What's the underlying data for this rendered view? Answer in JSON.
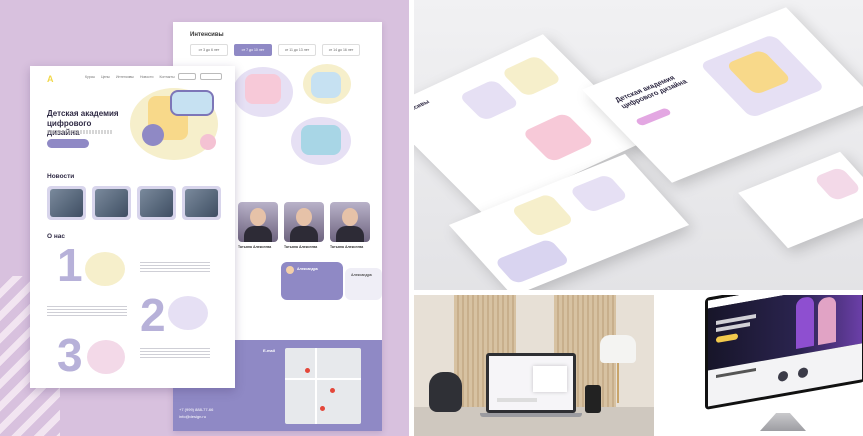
{
  "left_mockup": {
    "back_page": {
      "section_title": "Интенсивы",
      "tabs": [
        {
          "label": "от 3 до 6 лет",
          "active": false
        },
        {
          "label": "от 7 до 10 лет",
          "active": true
        },
        {
          "label": "от 11 до 13 лет",
          "active": false
        },
        {
          "label": "от 14 до 16 лет",
          "active": false
        }
      ],
      "people": [
        "Татьяна Алексеева",
        "Татьяна Алексеева",
        "Татьяна Алексеева"
      ],
      "chat_name": "Александра",
      "chat_name_2": "Александра",
      "footer_label": "E-mail",
      "footer_contacts": [
        "+7 (999) 888-77-66",
        "info@design.ru"
      ]
    },
    "front_page": {
      "logo": "A",
      "nav": [
        "Курсы",
        "Цены",
        "Интенсивы",
        "Новости",
        "Контакты"
      ],
      "hero_title": "Детская академия цифрового дизайна",
      "news_title": "Новости",
      "about_title": "О нас",
      "numbers": [
        "1",
        "2",
        "3"
      ]
    }
  },
  "right_mockup": {
    "intensives_title": "Интенсивы",
    "hero_title": "Детская академия цифрового дизайна"
  },
  "colors": {
    "brand_purple": "#8f89c5",
    "lavender_bg": "#d8c1de",
    "accent_yellow": "#f1d84a"
  }
}
